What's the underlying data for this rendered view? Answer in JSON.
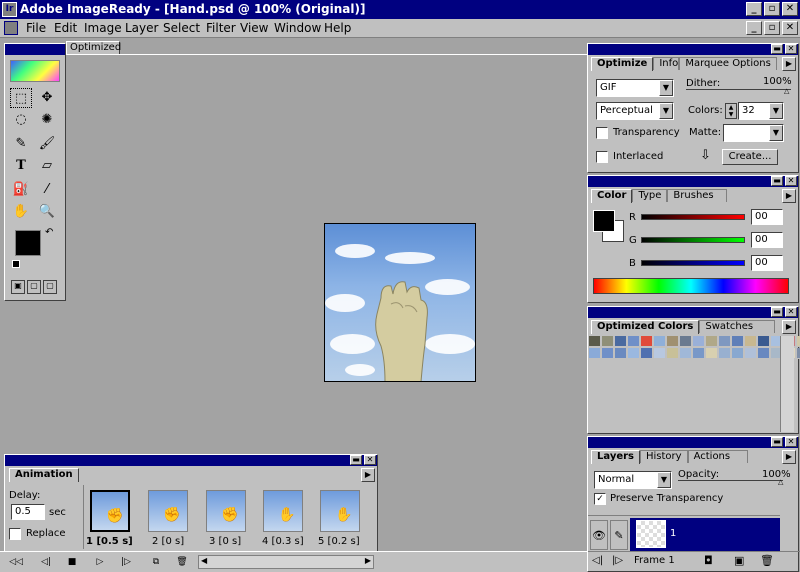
{
  "app": {
    "title": "Adobe ImageReady - [Hand.psd @ 100% (Original)]"
  },
  "menu": [
    "File",
    "Edit",
    "Image",
    "Layer",
    "Select",
    "Filter",
    "View",
    "Window",
    "Help"
  ],
  "document": {
    "tab": "Optimized"
  },
  "optimize": {
    "tabs": [
      "Optimize",
      "Info",
      "Marquee Options"
    ],
    "format": "GIF",
    "dither_label": "Dither:",
    "dither_value": "100%",
    "palette": "Perceptual",
    "colors_label": "Colors:",
    "colors_value": "32",
    "transparency_label": "Transparency",
    "matte_label": "Matte:",
    "interlaced_label": "Interlaced",
    "create_label": "Create..."
  },
  "color": {
    "tabs": [
      "Color",
      "Type",
      "Brushes"
    ],
    "r_label": "R",
    "g_label": "G",
    "b_label": "B",
    "r_value": "00",
    "g_value": "00",
    "b_value": "00"
  },
  "optimized_colors": {
    "tabs": [
      "Optimized Colors",
      "Swatches"
    ],
    "swatches": [
      "#5a5a4a",
      "#8f8f78",
      "#4a6aa0",
      "#6f8fc8",
      "#e04a3a",
      "#8fafd8",
      "#a09070",
      "#6a7a90",
      "#9ab0d8",
      "#b0a888",
      "#7f98c0",
      "#5f7fb8",
      "#c8b890",
      "#3a5a90",
      "#a8c0e0",
      "#c87a80",
      "#d0c8a8",
      "#90a0b8",
      "#8aaad8",
      "#7090c8",
      "#6a8ac0",
      "#9ab8e0",
      "#5070b0",
      "#b8c8e0",
      "#c8c098",
      "#a0b8d8",
      "#7898c8",
      "#d8d0b0",
      "#98b0d0",
      "#88a8d0",
      "#b0c0d8",
      "#6888c0",
      "#a8b8c8",
      "#e0d8c0",
      "#7f8fa8",
      "#90a8d0"
    ]
  },
  "layers": {
    "tabs": [
      "Layers",
      "History",
      "Actions"
    ],
    "mode": "Normal",
    "opacity_label": "Opacity:",
    "opacity_value": "100%",
    "preserve_label": "Preserve Transparency",
    "layer_name": "1",
    "frame_label": "Frame 1"
  },
  "animation": {
    "tab": "Animation",
    "delay_label": "Delay:",
    "delay_value": "0.5",
    "delay_unit": "sec",
    "replace_label": "Replace",
    "frames": [
      "1 [0.5 s]",
      "2 [0 s]",
      "3 [0 s]",
      "4 [0.3 s]",
      "5 [0.2 s]"
    ]
  }
}
